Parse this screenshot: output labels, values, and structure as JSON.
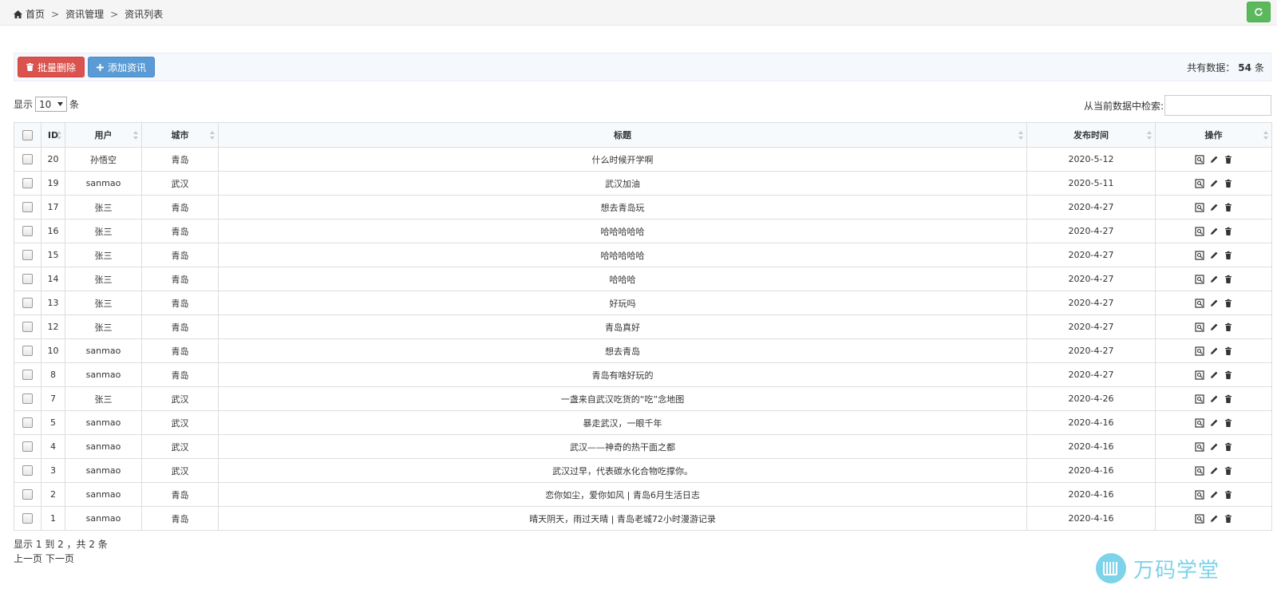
{
  "breadcrumb": {
    "home": "首页",
    "sep": ">",
    "level1": "资讯管理",
    "level2": "资讯列表"
  },
  "toolbar": {
    "batch_delete": "批量删除",
    "add_news": "添加资讯",
    "total_prefix": "共有数据：",
    "total_count": "54",
    "total_suffix": "条"
  },
  "length": {
    "prefix": "显示",
    "value": "10",
    "suffix": "条"
  },
  "search": {
    "label": "从当前数据中检索:",
    "value": ""
  },
  "table": {
    "headers": {
      "id": "ID",
      "user": "用户",
      "city": "城市",
      "title": "标题",
      "date": "发布时间",
      "ops": "操作"
    },
    "rows": [
      {
        "id": "20",
        "user": "孙悟空",
        "city": "青岛",
        "title": "什么时候开学啊",
        "date": "2020-5-12"
      },
      {
        "id": "19",
        "user": "sanmao",
        "city": "武汉",
        "title": "武汉加油",
        "date": "2020-5-11"
      },
      {
        "id": "17",
        "user": "张三",
        "city": "青岛",
        "title": "想去青岛玩",
        "date": "2020-4-27"
      },
      {
        "id": "16",
        "user": "张三",
        "city": "青岛",
        "title": "哈哈哈哈哈",
        "date": "2020-4-27"
      },
      {
        "id": "15",
        "user": "张三",
        "city": "青岛",
        "title": "哈哈哈哈哈",
        "date": "2020-4-27"
      },
      {
        "id": "14",
        "user": "张三",
        "city": "青岛",
        "title": "哈哈哈",
        "date": "2020-4-27"
      },
      {
        "id": "13",
        "user": "张三",
        "city": "青岛",
        "title": "好玩吗",
        "date": "2020-4-27"
      },
      {
        "id": "12",
        "user": "张三",
        "city": "青岛",
        "title": "青岛真好",
        "date": "2020-4-27"
      },
      {
        "id": "10",
        "user": "sanmao",
        "city": "青岛",
        "title": "想去青岛",
        "date": "2020-4-27"
      },
      {
        "id": "8",
        "user": "sanmao",
        "city": "青岛",
        "title": "青岛有啥好玩的",
        "date": "2020-4-27"
      },
      {
        "id": "7",
        "user": "张三",
        "city": "武汉",
        "title": "一盏来自武汉吃货的“吃”念地图",
        "date": "2020-4-26"
      },
      {
        "id": "5",
        "user": "sanmao",
        "city": "武汉",
        "title": "暴走武汉，一眼千年",
        "date": "2020-4-16"
      },
      {
        "id": "4",
        "user": "sanmao",
        "city": "武汉",
        "title": "武汉——神奇的热干面之都",
        "date": "2020-4-16"
      },
      {
        "id": "3",
        "user": "sanmao",
        "city": "武汉",
        "title": "武汉过早，代表碳水化合物吃撑你。",
        "date": "2020-4-16"
      },
      {
        "id": "2",
        "user": "sanmao",
        "city": "青岛",
        "title": "恋你如尘，爱你如风 | 青岛6月生活日志",
        "date": "2020-4-16"
      },
      {
        "id": "1",
        "user": "sanmao",
        "city": "青岛",
        "title": "晴天阴天，雨过天晴 | 青岛老城72小时漫游记录",
        "date": "2020-4-16"
      }
    ]
  },
  "info": "显示 1 到 2 ，共 2 条",
  "pager": {
    "prev": "上一页",
    "next": "下一页"
  },
  "watermark": "万码学堂",
  "colors": {
    "danger": "#d9534f",
    "primary": "#5b9bd5",
    "success": "#5cb85c",
    "watermark": "#7cd3ea"
  }
}
